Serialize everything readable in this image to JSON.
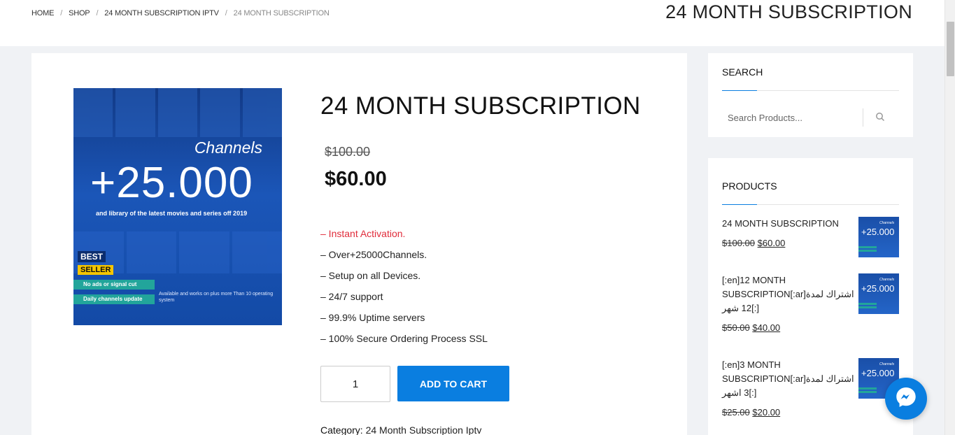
{
  "breadcrumb": {
    "items": [
      "HOME",
      "SHOP",
      "24 MONTH SUBSCRIPTION IPTV"
    ],
    "current": "24 MONTH SUBSCRIPTION",
    "separator": "/"
  },
  "header": {
    "title": "24 MONTH SUBSCRIPTION"
  },
  "product": {
    "title": "24 MONTH SUBSCRIPTION",
    "old_price": "$100.00",
    "new_price": "$60.00",
    "features": [
      "– Instant Activation.",
      "– Over+25000Channels.",
      "– Setup on all Devices.",
      "– 24/7 support",
      "– 99.9% Uptime servers",
      "– 100% Secure Ordering Process SSL"
    ],
    "quantity": "1",
    "add_to_cart_label": "ADD TO CART",
    "category_label": "Category:",
    "category_value": "24 Month Subscription Iptv",
    "image": {
      "channels_text": "Channels",
      "big_text": "+25.000",
      "sub_text": "and library of the latest movies and series off 2019",
      "badge_best": "BEST",
      "badge_seller": "SELLER",
      "tag1": "No ads or signal cut",
      "tag2": "Daily channels update",
      "available_text": "Available and works on plus more Than 10 operating system"
    }
  },
  "sidebar": {
    "search": {
      "title": "SEARCH",
      "placeholder": "Search Products..."
    },
    "products": {
      "title": "PRODUCTS",
      "items": [
        {
          "name": "24 MONTH SUBSCRIPTION",
          "old_price": "$100.00",
          "new_price": "$60.00"
        },
        {
          "name": "[:en]12 MONTH SUBSCRIPTION[:ar]اشتراك لمدة 12 شهر[:]",
          "old_price": "$50.00",
          "new_price": "$40.00"
        },
        {
          "name": "[:en]3 MONTH SUBSCRIPTION[:ar]اشتراك لمدة 3 اشهر[:]",
          "old_price": "$25.00",
          "new_price": "$20.00"
        }
      ],
      "thumb_big": "+25.000",
      "thumb_small": "Channels"
    }
  },
  "colors": {
    "accent": "#0a7ee0",
    "highlight": "#e02b3a",
    "background": "#f0f2f5"
  },
  "icons": {
    "search": "search-icon",
    "messenger": "messenger-icon"
  }
}
